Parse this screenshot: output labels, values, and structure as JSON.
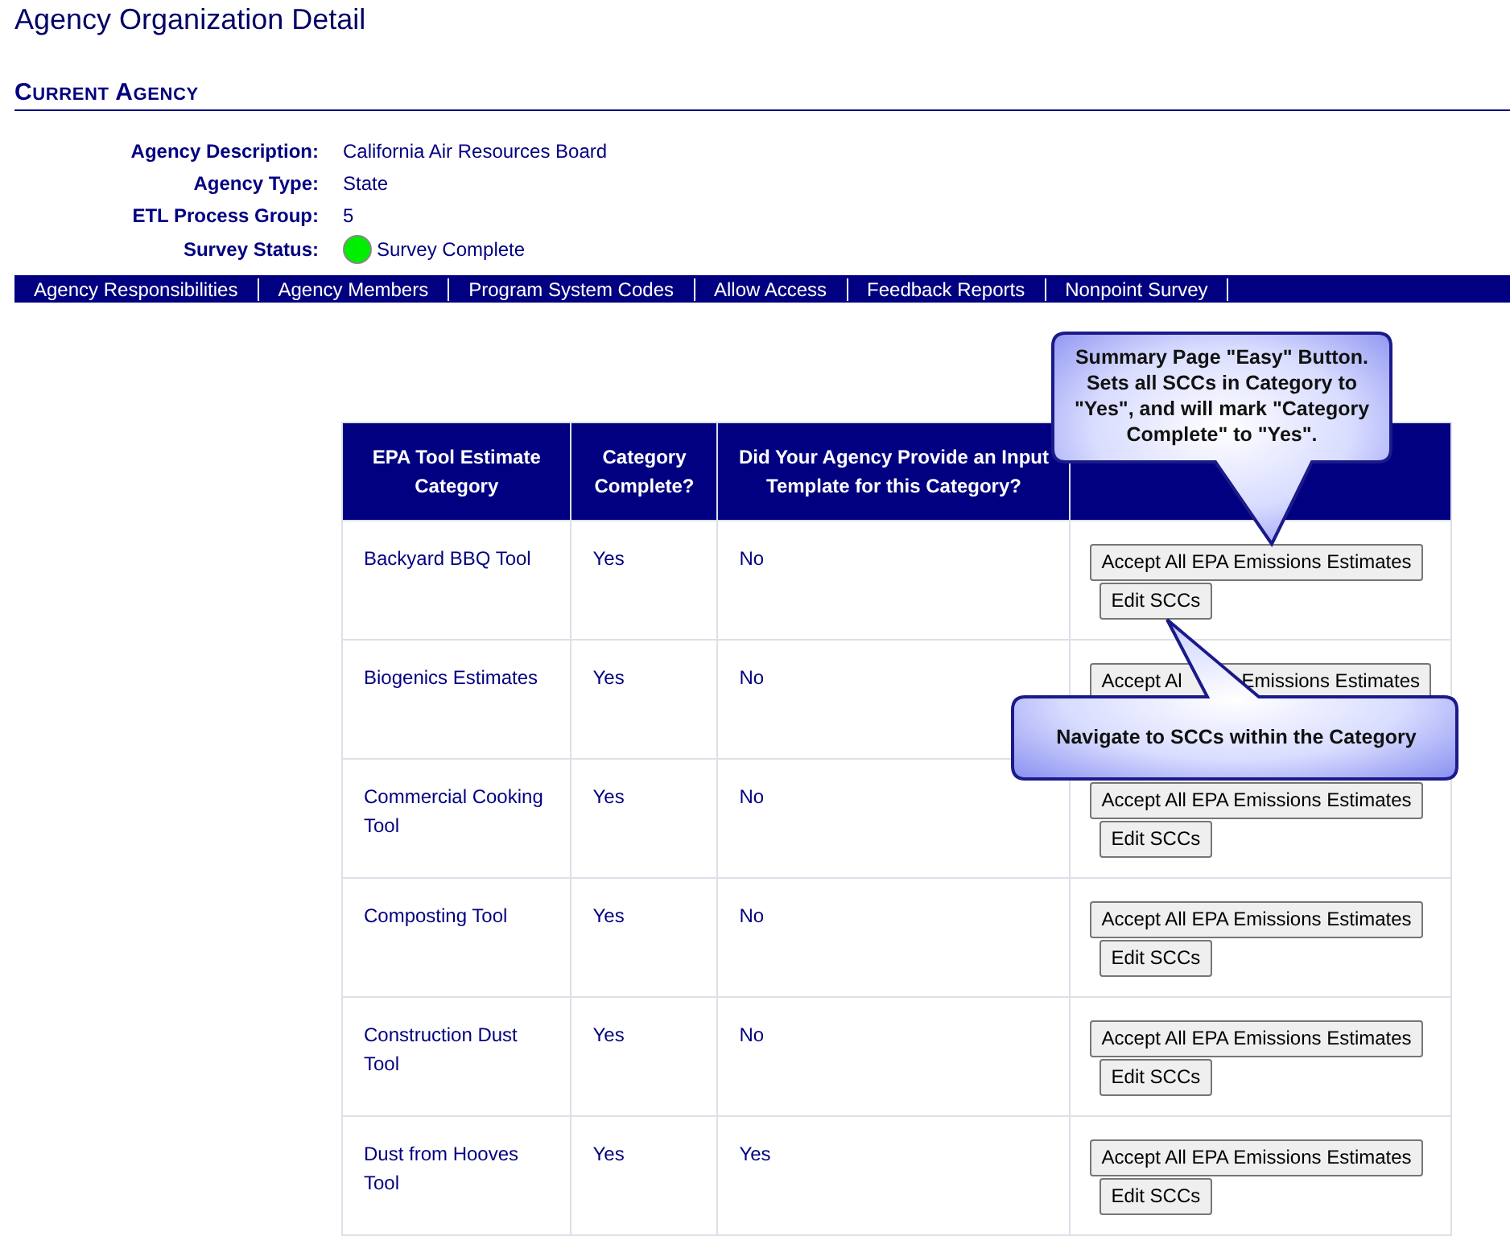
{
  "page_title": "Agency Organization Detail",
  "section_title": "Current Agency",
  "details": [
    {
      "label": "Agency Description:",
      "value": "California Air Resources Board"
    },
    {
      "label": "Agency Type:",
      "value": "State"
    },
    {
      "label": "ETL Process Group:",
      "value": "5"
    },
    {
      "label": "Survey Status:",
      "value": "Survey Complete",
      "complete": true
    }
  ],
  "nav": [
    "Agency Responsibilities",
    "Agency Members",
    "Program System Codes",
    "Allow Access",
    "Feedback Reports",
    "Nonpoint Survey"
  ],
  "table": {
    "columns": [
      "EPA Tool Estimate Category",
      "Category Complete?",
      "Did Your Agency Provide an Input Template for this Category?"
    ],
    "rows": [
      {
        "category": "Backyard BBQ Tool",
        "complete": "Yes",
        "template": "No",
        "buttons": [
          [
            "Accept All EPA Emissions Estimates"
          ],
          [
            "Edit SCCs"
          ]
        ]
      },
      {
        "category": "Biogenics Estimates",
        "complete": "Yes",
        "template": "No",
        "buttons": [
          [
            "Accept Al",
            "Emissions Estimates"
          ]
        ]
      },
      {
        "category": "Commercial Cooking Tool",
        "complete": "Yes",
        "template": "No",
        "buttons": [
          [
            "Accept All EPA Emissions Estimates"
          ],
          [
            "Edit SCCs"
          ]
        ]
      },
      {
        "category": "Composting Tool",
        "complete": "Yes",
        "template": "No",
        "buttons": [
          [
            "Accept All EPA Emissions Estimates"
          ],
          [
            "Edit SCCs"
          ]
        ]
      },
      {
        "category": "Construction Dust Tool",
        "complete": "Yes",
        "template": "No",
        "buttons": [
          [
            "Accept All EPA Emissions Estimates"
          ],
          [
            "Edit SCCs"
          ]
        ]
      },
      {
        "category": "Dust from Hooves Tool",
        "complete": "Yes",
        "template": "Yes",
        "buttons": [
          [
            "Accept All EPA Emissions Estimates"
          ],
          [
            "Edit SCCs"
          ]
        ]
      }
    ]
  },
  "callouts": [
    {
      "kind": "down",
      "text": "Summary Page \"Easy\" Button. Sets all SCCs in Category to \"Yes\", and will mark \"Category Complete\" to \"Yes\"."
    },
    {
      "kind": "up",
      "text": "Navigate to SCCs within the Category"
    }
  ]
}
